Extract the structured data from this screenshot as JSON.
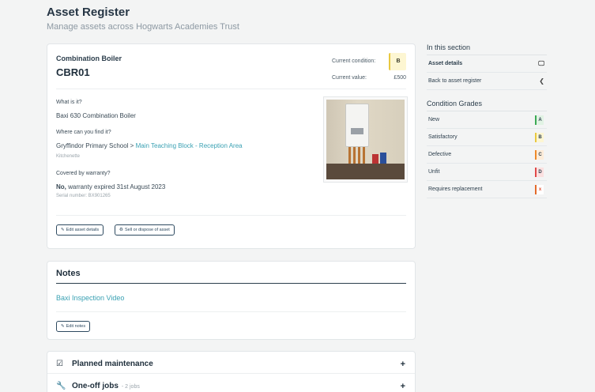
{
  "header": {
    "title": "Asset Register",
    "subtitle": "Manage assets across Hogwarts Academies Trust"
  },
  "asset": {
    "type": "Combination Boiler",
    "code": "CBR01",
    "condition_label": "Current condition:",
    "condition_grade": "B",
    "value_label": "Current value:",
    "value_amount": "£500",
    "what_label": "What is it?",
    "what_value": "Baxi 630 Combination Boiler",
    "where_label": "Where can you find it?",
    "where_school": "Gryffindor Primary School >",
    "where_block": "Main Teaching Block - Reception Area",
    "where_room": "Kitchenette",
    "warranty_label": "Covered by warranty?",
    "warranty_no": "No,",
    "warranty_text": "warranty expired 31st August 2023",
    "serial": "Serial number: BX901265",
    "edit_button": "Edit asset details",
    "sell_button": "Sell or dispose of asset"
  },
  "notes": {
    "title": "Notes",
    "link": "Baxi Inspection Video",
    "edit_button": "Edit notes"
  },
  "accordion": [
    {
      "label": "Planned maintenance",
      "count": "",
      "icon": "checkbox-icon"
    },
    {
      "label": "One-off jobs",
      "count": "- 2 jobs",
      "icon": "wrench-icon"
    }
  ],
  "sidebar": {
    "section_heading": "In this section",
    "items": [
      {
        "label": "Asset details",
        "icon": "monitor-icon",
        "active": true
      },
      {
        "label": "Back to asset register",
        "icon": "back-icon",
        "active": false
      }
    ],
    "grades_heading": "Condition Grades",
    "grades": [
      {
        "label": "New",
        "grade": "A",
        "bg": "#e1f3e4",
        "border": "#3caa55"
      },
      {
        "label": "Satisfactory",
        "grade": "B",
        "bg": "#fdf6d2",
        "border": "#e8c840"
      },
      {
        "label": "Defective",
        "grade": "C",
        "bg": "#fdecd9",
        "border": "#ee8a2a"
      },
      {
        "label": "Unfit",
        "grade": "D",
        "bg": "#fbe0e0",
        "border": "#e04a4a"
      },
      {
        "label": "Requires replacement",
        "grade": "x",
        "bg": "#ffffff",
        "border": "#e36a2a"
      }
    ]
  },
  "colors": {
    "accent": "#3aa1b3",
    "dark": "#1e2e3b"
  }
}
